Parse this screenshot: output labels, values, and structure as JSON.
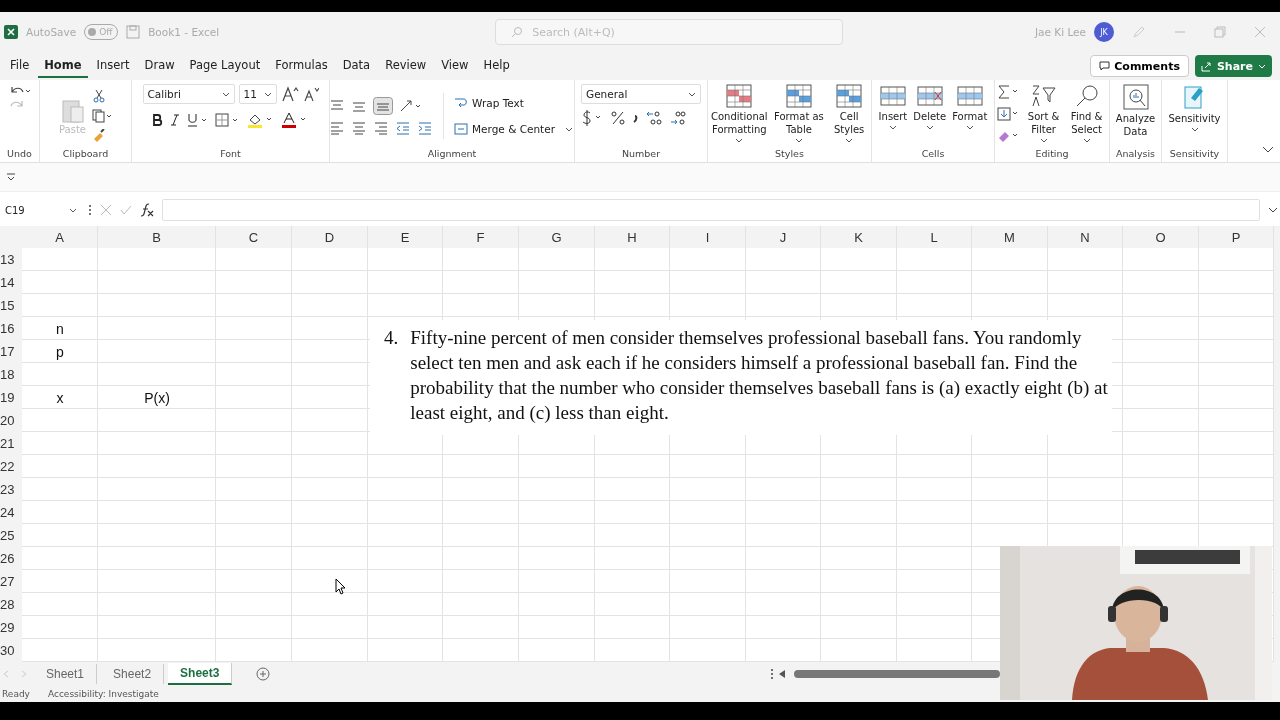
{
  "window": {
    "title": "Book1  -  Excel",
    "autosave": {
      "label": "AutoSave",
      "on": false,
      "state_text": "Off"
    },
    "search": {
      "placeholder": "Search (Alt+Q)"
    },
    "user": {
      "name": "Jae Ki Lee",
      "initials": "JK"
    }
  },
  "menu_tabs": [
    {
      "label": "File",
      "selected": false
    },
    {
      "label": "Home",
      "selected": true
    },
    {
      "label": "Insert",
      "selected": false
    },
    {
      "label": "Draw",
      "selected": false
    },
    {
      "label": "Page Layout",
      "selected": false
    },
    {
      "label": "Formulas",
      "selected": false
    },
    {
      "label": "Data",
      "selected": false
    },
    {
      "label": "Review",
      "selected": false
    },
    {
      "label": "View",
      "selected": false
    },
    {
      "label": "Help",
      "selected": false
    }
  ],
  "actions": {
    "comments": "Comments",
    "share": "Share"
  },
  "ribbon": {
    "undo": {
      "label": "Undo"
    },
    "clipboard": {
      "label": "Clipboard",
      "paste": {
        "label": "Paste",
        "disabled": true
      }
    },
    "font": {
      "label": "Font",
      "family": "Calibri",
      "size": "11"
    },
    "alignment": {
      "label": "Alignment",
      "wrap_text": "Wrap Text",
      "merge_center": "Merge & Center"
    },
    "number": {
      "label": "Number",
      "format": "General"
    },
    "styles": {
      "label": "Styles",
      "buttons": [
        "Conditional Formatting",
        "Format as Table",
        "Cell Styles"
      ]
    },
    "cells": {
      "label": "Cells",
      "buttons": [
        "Insert",
        "Delete",
        "Format"
      ]
    },
    "editing": {
      "label": "Editing",
      "buttons": [
        "Sort & Filter",
        "Find & Select"
      ]
    },
    "analysis": {
      "label": "Analysis",
      "buttons": [
        "Analyze Data"
      ]
    },
    "sensitivity": {
      "label": "Sensitivity",
      "buttons": [
        "Sensitivity"
      ]
    }
  },
  "formula_bar": {
    "name_box": "C19"
  },
  "sheet": {
    "columns": [
      "A",
      "B",
      "C",
      "D",
      "E",
      "F",
      "G",
      "H",
      "I",
      "J",
      "K",
      "L",
      "M",
      "N",
      "O",
      "P"
    ],
    "rows": [
      {
        "number": "13"
      },
      {
        "number": "14"
      },
      {
        "number": "15"
      },
      {
        "number": "16",
        "A": "n"
      },
      {
        "number": "17",
        "A": "p"
      },
      {
        "number": "18"
      },
      {
        "number": "19",
        "A": "x",
        "B": "P(x)"
      },
      {
        "number": "20"
      },
      {
        "number": "21"
      },
      {
        "number": "22"
      },
      {
        "number": "23"
      },
      {
        "number": "24"
      },
      {
        "number": "25"
      },
      {
        "number": "26"
      },
      {
        "number": "27"
      },
      {
        "number": "28"
      },
      {
        "number": "29"
      },
      {
        "number": "30"
      }
    ]
  },
  "problem": {
    "number": "4.",
    "text": "Fifty-nine percent of men consider themselves professional baseball fans. You randomly select ten men and ask each if he considers himself a professional baseball fan. Find the probability that the number who consider themselves baseball fans is (a) exactly eight (b) at least eight, and (c) less than eight."
  },
  "sheet_tabs": [
    {
      "label": "Sheet1",
      "selected": false
    },
    {
      "label": "Sheet2",
      "selected": false
    },
    {
      "label": "Sheet3",
      "selected": true
    }
  ],
  "status_bar": {
    "ready": "Ready",
    "accessibility": "Accessibility: Investigate"
  }
}
